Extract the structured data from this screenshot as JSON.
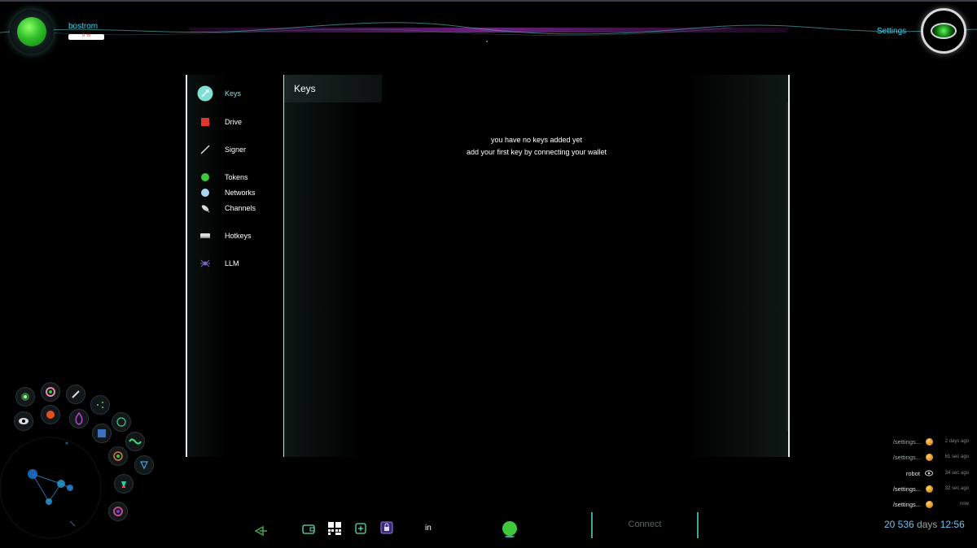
{
  "header": {
    "network_name": "bostrom",
    "sync_progress": "0 %",
    "settings_label": "Settings"
  },
  "sidebar": {
    "items": [
      {
        "label": "Keys",
        "icon": "key-icon",
        "active": true
      },
      {
        "label": "Drive",
        "icon": "drive-icon"
      },
      {
        "label": "Signer",
        "icon": "pen-icon"
      },
      {
        "label": "Tokens",
        "icon": "token-icon"
      },
      {
        "label": "Networks",
        "icon": "network-icon"
      },
      {
        "label": "Channels",
        "icon": "satellite-icon"
      },
      {
        "label": "Hotkeys",
        "icon": "keyboard-icon"
      },
      {
        "label": "LLM",
        "icon": "spider-icon"
      }
    ]
  },
  "content": {
    "title": "Keys",
    "empty_line1": "you have no keys added yet",
    "empty_line2": "add your first key by connecting your wallet"
  },
  "bottombar": {
    "in_label": "in",
    "connect_label": "Connect"
  },
  "activity": [
    {
      "title": "/settings...",
      "time": "2 days ago",
      "icon": "orange-dot"
    },
    {
      "title": "/settings...",
      "time": "61 sec ago",
      "icon": "orange-dot"
    },
    {
      "title": "robot",
      "time": "34 sec ago",
      "icon": "eye-icon"
    },
    {
      "title": "/settings...",
      "time": "32 sec ago",
      "icon": "orange-dot"
    },
    {
      "title": "/settings...",
      "time": "now",
      "icon": "orange-dot"
    }
  ],
  "clock": {
    "days": "20 536",
    "days_unit": "days",
    "time": "12:56"
  },
  "colors": {
    "accent": "#36d6f2",
    "active": "#7fe0d3",
    "connect_border": "#3aa89c"
  }
}
